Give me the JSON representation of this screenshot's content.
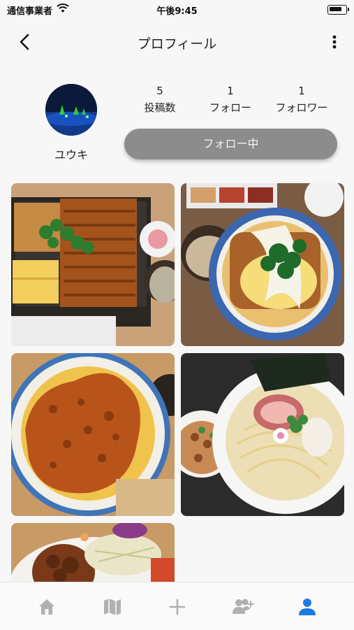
{
  "status_bar": {
    "carrier": "通信事業者",
    "time": "午後9:45"
  },
  "nav": {
    "title": "プロフィール"
  },
  "profile": {
    "username": "ユウキ",
    "stats": [
      {
        "value": "5",
        "label": "投稿数"
      },
      {
        "value": "1",
        "label": "フォロー"
      },
      {
        "value": "1",
        "label": "フォロワー"
      }
    ],
    "follow_button_label": "フォロー中"
  },
  "posts": [
    {
      "icon": "food-photo-unagi-bento"
    },
    {
      "icon": "food-photo-katsudon"
    },
    {
      "icon": "food-photo-sauce-katsudon"
    },
    {
      "icon": "food-photo-ramen"
    },
    {
      "icon": "food-photo-karaage"
    }
  ],
  "tabs": [
    {
      "icon": "home-icon",
      "active": false
    },
    {
      "icon": "map-icon",
      "active": false
    },
    {
      "icon": "plus-icon",
      "active": false
    },
    {
      "icon": "add-user-icon",
      "active": false
    },
    {
      "icon": "profile-icon",
      "active": true
    }
  ],
  "colors": {
    "accent": "#1f7ae0",
    "inactive_tab": "#b0b0b0",
    "follow_button": "#8c8c8c"
  }
}
